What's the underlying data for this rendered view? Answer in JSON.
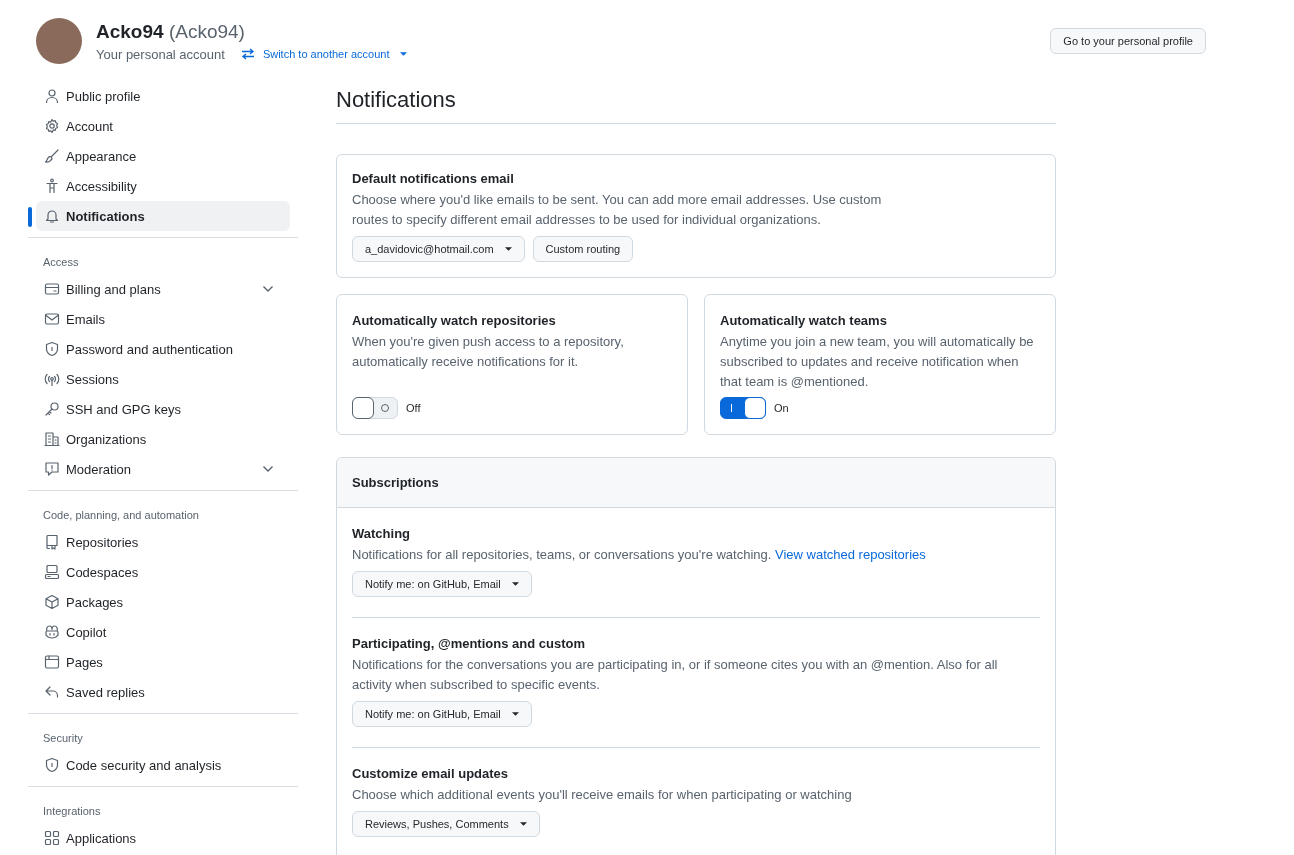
{
  "header": {
    "name": "Acko94",
    "login": "(Acko94)",
    "subtitle": "Your personal account",
    "switch_link": "Switch to another account",
    "profile_button": "Go to your personal profile"
  },
  "sidebar": {
    "sections": [
      {
        "items": [
          {
            "label": "Public profile",
            "selected": false,
            "expandable": false
          },
          {
            "label": "Account",
            "selected": false,
            "expandable": false
          },
          {
            "label": "Appearance",
            "selected": false,
            "expandable": false
          },
          {
            "label": "Accessibility",
            "selected": false,
            "expandable": false
          },
          {
            "label": "Notifications",
            "selected": true,
            "expandable": false
          }
        ]
      },
      {
        "heading": "Access",
        "items": [
          {
            "label": "Billing and plans",
            "selected": false,
            "expandable": true
          },
          {
            "label": "Emails",
            "selected": false,
            "expandable": false
          },
          {
            "label": "Password and authentication",
            "selected": false,
            "expandable": false
          },
          {
            "label": "Sessions",
            "selected": false,
            "expandable": false
          },
          {
            "label": "SSH and GPG keys",
            "selected": false,
            "expandable": false
          },
          {
            "label": "Organizations",
            "selected": false,
            "expandable": false
          },
          {
            "label": "Moderation",
            "selected": false,
            "expandable": true
          }
        ]
      },
      {
        "heading": "Code, planning, and automation",
        "items": [
          {
            "label": "Repositories",
            "selected": false,
            "expandable": false
          },
          {
            "label": "Codespaces",
            "selected": false,
            "expandable": false
          },
          {
            "label": "Packages",
            "selected": false,
            "expandable": false
          },
          {
            "label": "Copilot",
            "selected": false,
            "expandable": false
          },
          {
            "label": "Pages",
            "selected": false,
            "expandable": false
          },
          {
            "label": "Saved replies",
            "selected": false,
            "expandable": false
          }
        ]
      },
      {
        "heading": "Security",
        "items": [
          {
            "label": "Code security and analysis",
            "selected": false,
            "expandable": false
          }
        ]
      },
      {
        "heading": "Integrations",
        "items": [
          {
            "label": "Applications",
            "selected": false,
            "expandable": false
          }
        ]
      }
    ]
  },
  "page_title": "Notifications",
  "default_email": {
    "title": "Default notifications email",
    "description": "Choose where you'd like emails to be sent. You can add more email addresses. Use custom routes to specify different email addresses to be used for individual organizations.",
    "email_select": "a_davidovic@hotmail.com",
    "routing_button": "Custom routing"
  },
  "watch_cards": [
    {
      "title": "Automatically watch repositories",
      "description": "When you're given push access to a repository, automatically receive notifications for it.",
      "on": false,
      "toggle_label": "Off"
    },
    {
      "title": "Automatically watch teams",
      "description": "Anytime you join a new team, you will automatically be subscribed to updates and receive notification when that team is @mentioned.",
      "on": true,
      "toggle_label": "On"
    }
  ],
  "subscriptions": {
    "heading": "Subscriptions",
    "items": [
      {
        "title": "Watching",
        "description": "Notifications for all repositories, teams, or conversations you're watching.",
        "link": "View watched repositories",
        "select": "Notify me: on GitHub, Email"
      },
      {
        "title": "Participating, @mentions and custom",
        "description": "Notifications for the conversations you are participating in, or if someone cites you with an @mention. Also for all activity when subscribed to specific events.",
        "select": "Notify me: on GitHub, Email"
      },
      {
        "title": "Customize email updates",
        "description": "Choose which additional events you'll receive emails for when participating or watching",
        "select": "Reviews, Pushes, Comments"
      }
    ]
  }
}
